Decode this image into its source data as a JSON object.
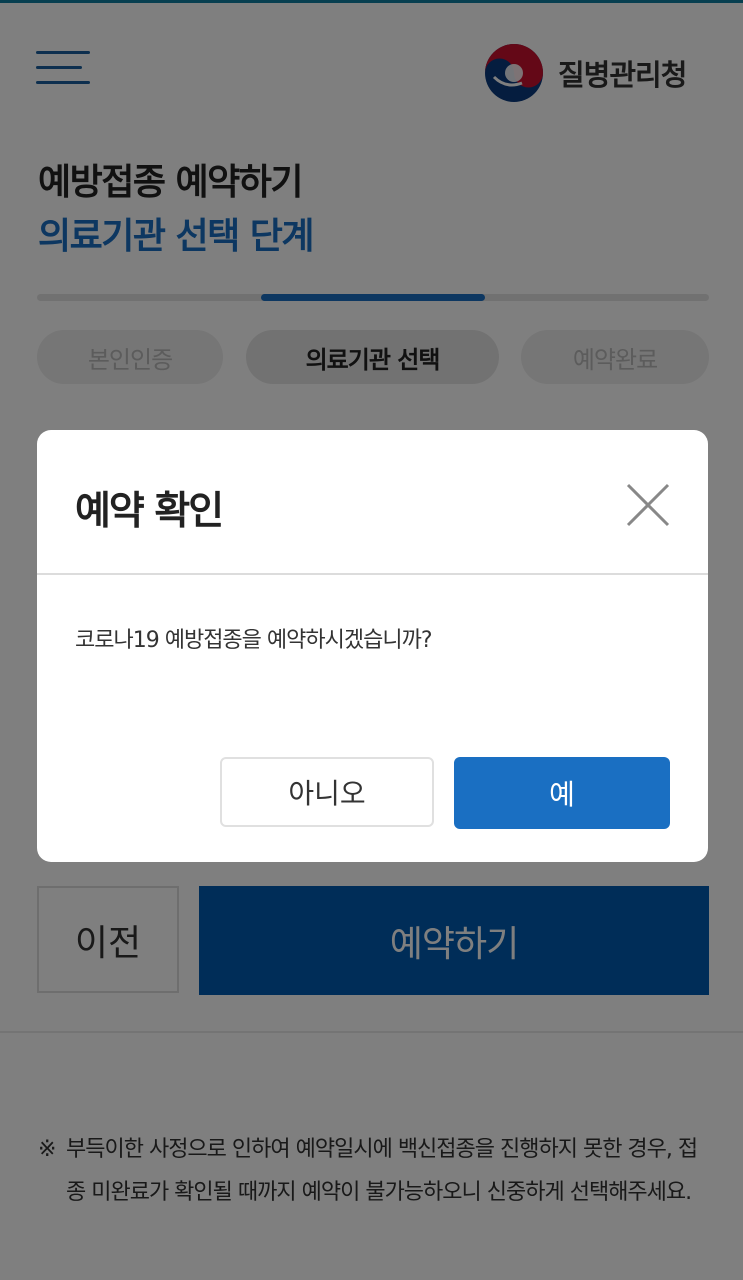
{
  "header": {
    "agency_name": "질병관리청",
    "title_line1": "예방접종 예약하기",
    "title_line2": "의료기관 선택 단계"
  },
  "progress": {
    "current_step": 2,
    "total_steps": 3
  },
  "steps": [
    {
      "label": "본인인증"
    },
    {
      "label": "의료기관 선택"
    },
    {
      "label": "예약완료"
    }
  ],
  "actions": {
    "prev_label": "이전",
    "book_label": "예약하기"
  },
  "notice": {
    "mark": "※",
    "text": "부득이한 사정으로 인하여 예약일시에 백신접종을 진행하지 못한 경우, 접종 미완료가 확인될 때까지 예약이 불가능하오니 신중하게 선택해주세요."
  },
  "modal": {
    "title": "예약 확인",
    "message": "코로나19 예방접종을 예약하시겠습니까?",
    "no_label": "아니오",
    "yes_label": "예"
  },
  "colors": {
    "primary": "#1a6fc2",
    "dark_primary": "#005bb0",
    "logo_red": "#c8102e",
    "logo_blue": "#0b3a7e"
  },
  "icons": {
    "menu": "hamburger-menu-icon",
    "logo": "taegeuk-logo-icon",
    "close": "close-icon"
  }
}
